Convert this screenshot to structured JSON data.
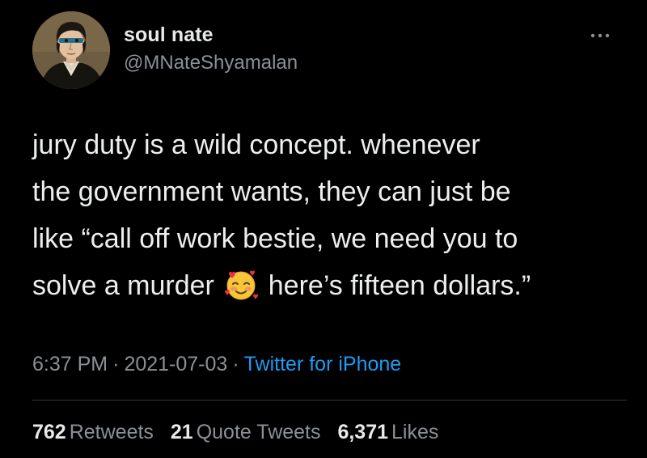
{
  "author": {
    "display_name": "soul nate",
    "handle": "@MNateShyamalan",
    "avatar_icon": "portrait-avatar"
  },
  "menu_icon": "more-options-icon",
  "tweet": {
    "line1": "jury duty is a wild concept. whenever",
    "line2": "the government wants, they can just be",
    "line3": "like “call off work bestie, we need you to",
    "line4_before": "solve a murder ",
    "emoji": "smiling-face-with-hearts-emoji",
    "line4_after": " here’s fifteen dollars.”"
  },
  "meta": {
    "time": "6:37 PM",
    "separator": "·",
    "date": "2021-07-03",
    "source": "Twitter for iPhone"
  },
  "stats": {
    "retweets_count": "762",
    "retweets_label": "Retweets",
    "quotes_count": "21",
    "quotes_label": "Quote Tweets",
    "likes_count": "6,371",
    "likes_label": "Likes"
  },
  "colors": {
    "background": "#000000",
    "text": "#e7e9ea",
    "secondary": "#8b9096",
    "link": "#1d9bf0",
    "divider": "#2f3336"
  }
}
